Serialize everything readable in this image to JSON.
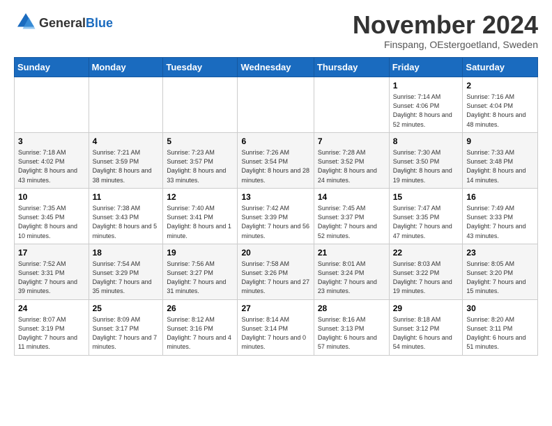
{
  "logo": {
    "line1": "General",
    "line2": "Blue"
  },
  "header": {
    "month": "November 2024",
    "location": "Finspang, OEstergoetland, Sweden"
  },
  "weekdays": [
    "Sunday",
    "Monday",
    "Tuesday",
    "Wednesday",
    "Thursday",
    "Friday",
    "Saturday"
  ],
  "weeks": [
    [
      {
        "day": "",
        "info": ""
      },
      {
        "day": "",
        "info": ""
      },
      {
        "day": "",
        "info": ""
      },
      {
        "day": "",
        "info": ""
      },
      {
        "day": "",
        "info": ""
      },
      {
        "day": "1",
        "info": "Sunrise: 7:14 AM\nSunset: 4:06 PM\nDaylight: 8 hours and 52 minutes."
      },
      {
        "day": "2",
        "info": "Sunrise: 7:16 AM\nSunset: 4:04 PM\nDaylight: 8 hours and 48 minutes."
      }
    ],
    [
      {
        "day": "3",
        "info": "Sunrise: 7:18 AM\nSunset: 4:02 PM\nDaylight: 8 hours and 43 minutes."
      },
      {
        "day": "4",
        "info": "Sunrise: 7:21 AM\nSunset: 3:59 PM\nDaylight: 8 hours and 38 minutes."
      },
      {
        "day": "5",
        "info": "Sunrise: 7:23 AM\nSunset: 3:57 PM\nDaylight: 8 hours and 33 minutes."
      },
      {
        "day": "6",
        "info": "Sunrise: 7:26 AM\nSunset: 3:54 PM\nDaylight: 8 hours and 28 minutes."
      },
      {
        "day": "7",
        "info": "Sunrise: 7:28 AM\nSunset: 3:52 PM\nDaylight: 8 hours and 24 minutes."
      },
      {
        "day": "8",
        "info": "Sunrise: 7:30 AM\nSunset: 3:50 PM\nDaylight: 8 hours and 19 minutes."
      },
      {
        "day": "9",
        "info": "Sunrise: 7:33 AM\nSunset: 3:48 PM\nDaylight: 8 hours and 14 minutes."
      }
    ],
    [
      {
        "day": "10",
        "info": "Sunrise: 7:35 AM\nSunset: 3:45 PM\nDaylight: 8 hours and 10 minutes."
      },
      {
        "day": "11",
        "info": "Sunrise: 7:38 AM\nSunset: 3:43 PM\nDaylight: 8 hours and 5 minutes."
      },
      {
        "day": "12",
        "info": "Sunrise: 7:40 AM\nSunset: 3:41 PM\nDaylight: 8 hours and 1 minute."
      },
      {
        "day": "13",
        "info": "Sunrise: 7:42 AM\nSunset: 3:39 PM\nDaylight: 7 hours and 56 minutes."
      },
      {
        "day": "14",
        "info": "Sunrise: 7:45 AM\nSunset: 3:37 PM\nDaylight: 7 hours and 52 minutes."
      },
      {
        "day": "15",
        "info": "Sunrise: 7:47 AM\nSunset: 3:35 PM\nDaylight: 7 hours and 47 minutes."
      },
      {
        "day": "16",
        "info": "Sunrise: 7:49 AM\nSunset: 3:33 PM\nDaylight: 7 hours and 43 minutes."
      }
    ],
    [
      {
        "day": "17",
        "info": "Sunrise: 7:52 AM\nSunset: 3:31 PM\nDaylight: 7 hours and 39 minutes."
      },
      {
        "day": "18",
        "info": "Sunrise: 7:54 AM\nSunset: 3:29 PM\nDaylight: 7 hours and 35 minutes."
      },
      {
        "day": "19",
        "info": "Sunrise: 7:56 AM\nSunset: 3:27 PM\nDaylight: 7 hours and 31 minutes."
      },
      {
        "day": "20",
        "info": "Sunrise: 7:58 AM\nSunset: 3:26 PM\nDaylight: 7 hours and 27 minutes."
      },
      {
        "day": "21",
        "info": "Sunrise: 8:01 AM\nSunset: 3:24 PM\nDaylight: 7 hours and 23 minutes."
      },
      {
        "day": "22",
        "info": "Sunrise: 8:03 AM\nSunset: 3:22 PM\nDaylight: 7 hours and 19 minutes."
      },
      {
        "day": "23",
        "info": "Sunrise: 8:05 AM\nSunset: 3:20 PM\nDaylight: 7 hours and 15 minutes."
      }
    ],
    [
      {
        "day": "24",
        "info": "Sunrise: 8:07 AM\nSunset: 3:19 PM\nDaylight: 7 hours and 11 minutes."
      },
      {
        "day": "25",
        "info": "Sunrise: 8:09 AM\nSunset: 3:17 PM\nDaylight: 7 hours and 7 minutes."
      },
      {
        "day": "26",
        "info": "Sunrise: 8:12 AM\nSunset: 3:16 PM\nDaylight: 7 hours and 4 minutes."
      },
      {
        "day": "27",
        "info": "Sunrise: 8:14 AM\nSunset: 3:14 PM\nDaylight: 7 hours and 0 minutes."
      },
      {
        "day": "28",
        "info": "Sunrise: 8:16 AM\nSunset: 3:13 PM\nDaylight: 6 hours and 57 minutes."
      },
      {
        "day": "29",
        "info": "Sunrise: 8:18 AM\nSunset: 3:12 PM\nDaylight: 6 hours and 54 minutes."
      },
      {
        "day": "30",
        "info": "Sunrise: 8:20 AM\nSunset: 3:11 PM\nDaylight: 6 hours and 51 minutes."
      }
    ]
  ]
}
